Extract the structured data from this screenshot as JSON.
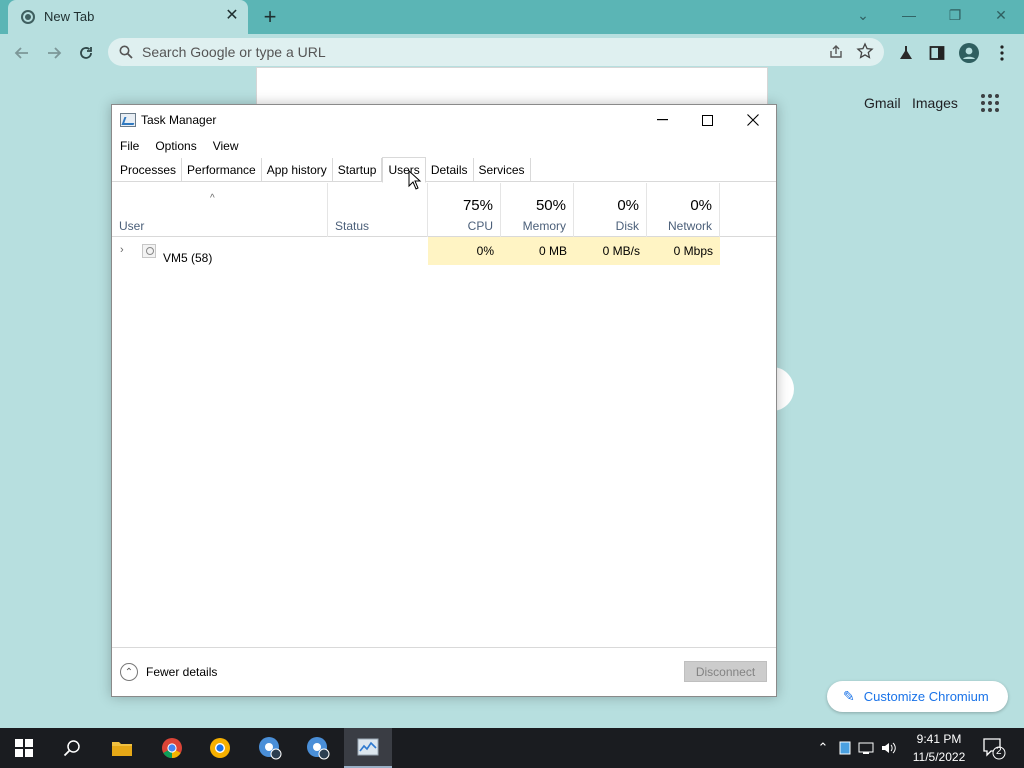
{
  "browser": {
    "tab_title": "New Tab",
    "tab_close": "✕",
    "new_tab": "+",
    "omnibox_placeholder": "Search Google or type a URL",
    "window_controls": {
      "dropdown": "⌄",
      "minimize": "—",
      "restore": "❐",
      "close": "✕"
    }
  },
  "ntp": {
    "gmail_link": "Gmail",
    "images_link": "Images",
    "customize_label": "Customize Chromium"
  },
  "task_manager": {
    "title": "Task Manager",
    "menu": [
      "File",
      "Options",
      "View"
    ],
    "tabs": [
      "Processes",
      "Performance",
      "App history",
      "Startup",
      "Users",
      "Details",
      "Services"
    ],
    "active_tab": "Users",
    "columns": {
      "user": {
        "label": "User"
      },
      "status": {
        "label": "Status"
      },
      "cpu": {
        "percent": "75%",
        "label": "CPU"
      },
      "memory": {
        "percent": "50%",
        "label": "Memory"
      },
      "disk": {
        "percent": "0%",
        "label": "Disk"
      },
      "network": {
        "percent": "0%",
        "label": "Network"
      }
    },
    "rows": [
      {
        "user": "VM5 (58)",
        "status": "",
        "cpu": "0%",
        "memory": "0 MB",
        "disk": "0 MB/s",
        "network": "0 Mbps"
      }
    ],
    "footer": {
      "fewer_details": "Fewer details",
      "disconnect": "Disconnect"
    }
  },
  "taskbar": {
    "clock_time": "9:41 PM",
    "clock_date": "11/5/2022",
    "notification_count": "2"
  },
  "colors": {
    "desktop_bg": "#b7dfdf",
    "tabstrip_bg": "#5bb5b5",
    "usage_highlight": "#fff4c4",
    "link_blue": "#1a73e8"
  }
}
